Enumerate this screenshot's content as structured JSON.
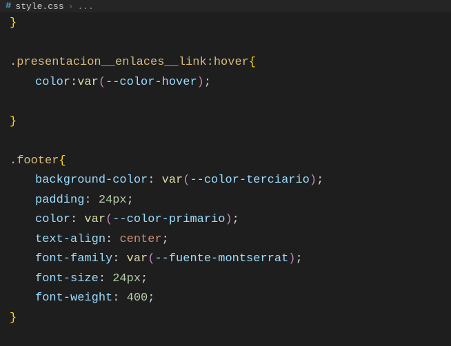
{
  "tab": {
    "icon_label": "#",
    "filename": "style.css",
    "separator": "›",
    "breadcrumb": "..."
  },
  "code": {
    "line1_brace": "}",
    "blank": " ",
    "rule1_selector": ".presentacion__enlaces__link",
    "rule1_pseudo": ":hover",
    "open_brace": "{",
    "prop_color": "color",
    "colon": ":",
    "colon_sp": ": ",
    "func_var": "var",
    "paren_open": "(",
    "paren_close": ")",
    "var_hover": "--color-hover",
    "semi": ";",
    "close_brace": "}",
    "rule2_selector": ".footer",
    "prop_bg": "background-color",
    "var_terciario": "--color-terciario",
    "prop_padding": "padding",
    "val_24px": "24px",
    "var_primario": "--color-primario",
    "prop_textalign": "text-align",
    "val_center": "center",
    "prop_fontfamily": "font-family",
    "var_montserrat": "--fuente-montserrat",
    "prop_fontsize": "font-size",
    "prop_fontweight": "font-weight",
    "val_400": "400"
  }
}
